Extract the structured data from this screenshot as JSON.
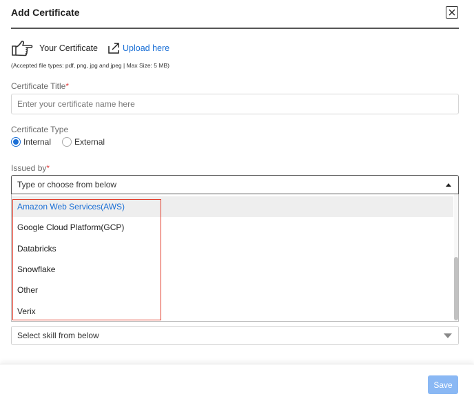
{
  "modal": {
    "title": "Add Certificate"
  },
  "upload": {
    "your_certificate": "Your Certificate",
    "upload_link": "Upload here",
    "accepted_types": "(Accepted file types: pdf, png, jpg and jpeg | Max Size: 5 MB)"
  },
  "certificate_title": {
    "label": "Certificate Title",
    "required_mark": "*",
    "placeholder": "Enter your certificate name here",
    "value": ""
  },
  "certificate_type": {
    "label": "Certificate Type",
    "options": [
      {
        "label": "Internal",
        "checked": true
      },
      {
        "label": "External",
        "checked": false
      }
    ]
  },
  "issued_by": {
    "label": "Issued by",
    "required_mark": "*",
    "placeholder": "Type or choose from below",
    "options": [
      "Amazon Web Services(AWS)",
      "Google Cloud Platform(GCP)",
      "Databricks",
      "Snowflake",
      "Other",
      "Verix"
    ],
    "highlighted_index": 0
  },
  "skill": {
    "placeholder": "Select skill from below"
  },
  "footer": {
    "save_label": "Save"
  },
  "colors": {
    "accent": "#1a6fd6",
    "save_disabled": "#8ab8f4",
    "annotation_red": "#e23b2a",
    "required_red": "#e04040"
  },
  "icons": {
    "close": "close-icon",
    "hand": "pointing-hand-icon",
    "upload": "external-link-icon",
    "caret_up": "caret-up-icon",
    "caret_down": "caret-down-icon"
  }
}
